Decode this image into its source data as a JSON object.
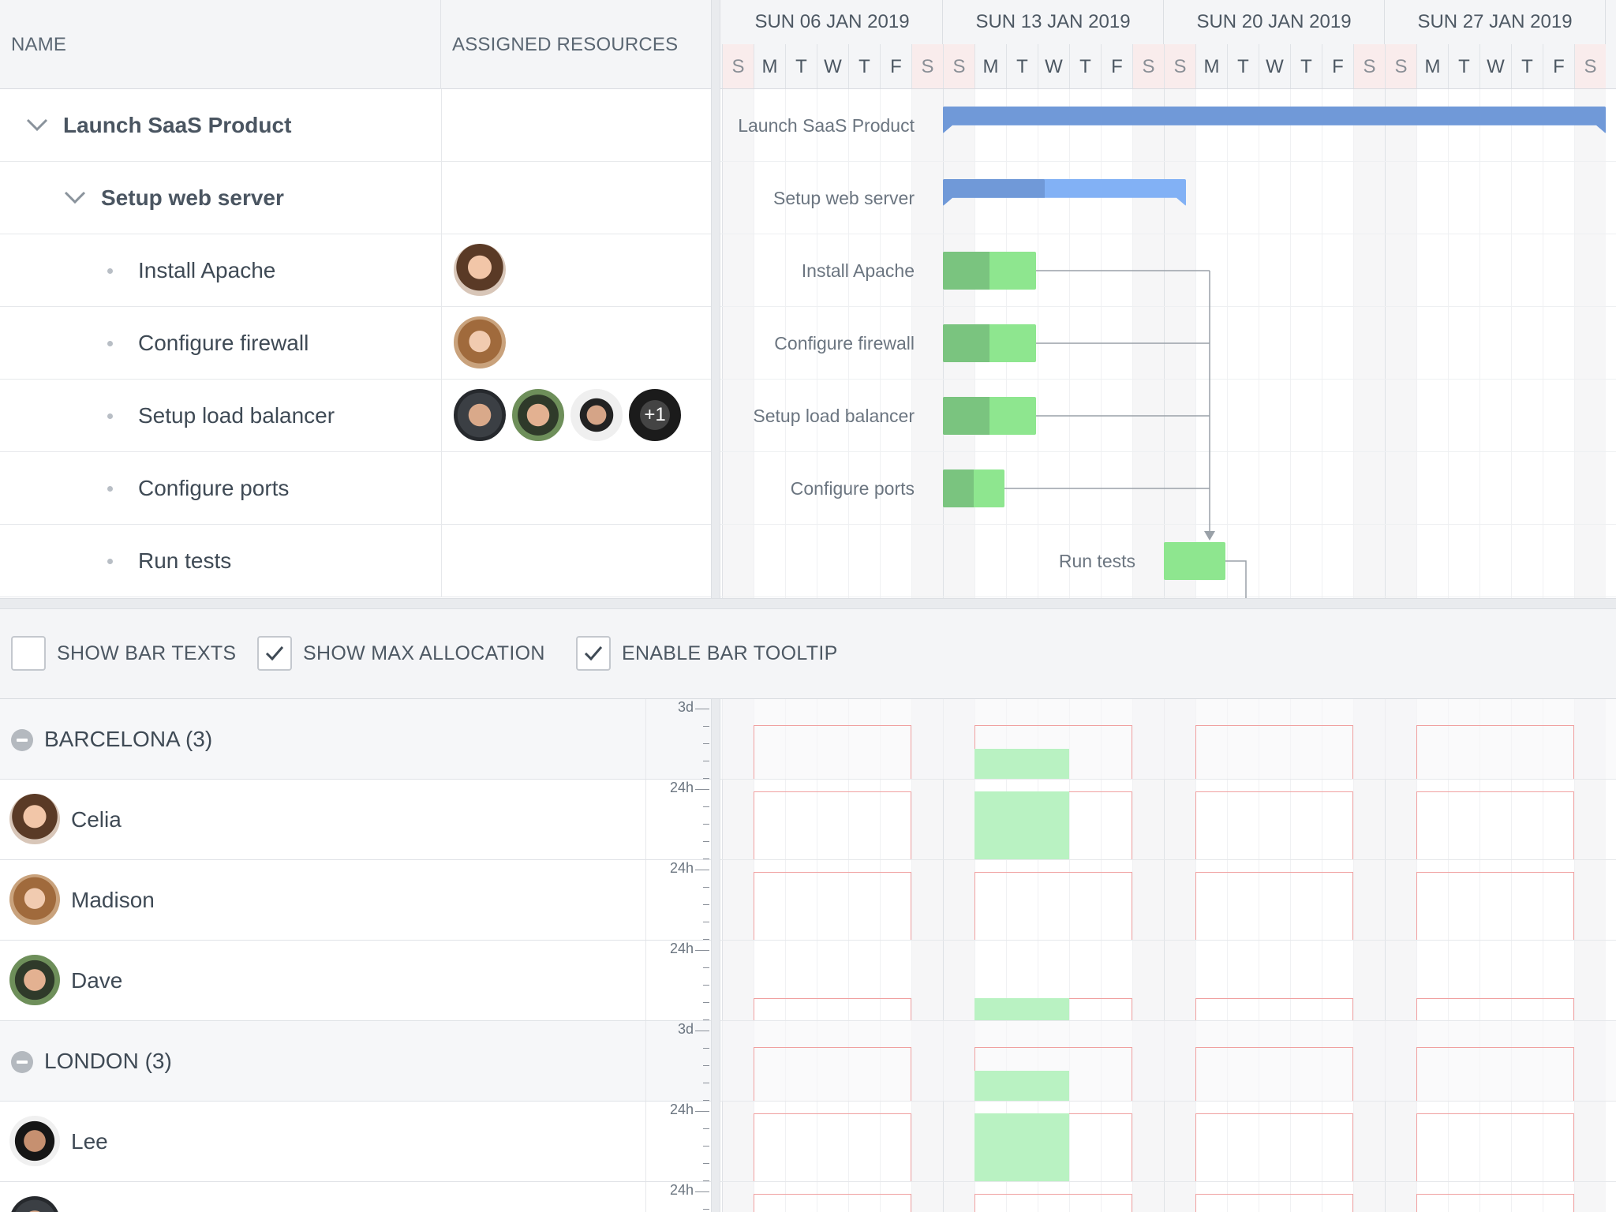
{
  "columns": {
    "name": "NAME",
    "resources": "ASSIGNED RESOURCES"
  },
  "weeks": [
    "SUN 06 JAN 2019",
    "SUN 13 JAN 2019",
    "SUN 20 JAN 2019",
    "SUN 27 JAN 2019"
  ],
  "days": [
    "S",
    "M",
    "T",
    "W",
    "T",
    "F",
    "S",
    "S",
    "M",
    "T",
    "W",
    "T",
    "F",
    "S",
    "S",
    "M",
    "T",
    "W",
    "T",
    "F",
    "S",
    "S",
    "M",
    "T",
    "W",
    "T",
    "F",
    "S"
  ],
  "tasks": [
    {
      "name": "Launch SaaS Product",
      "label": "Launch SaaS Product",
      "level": 0,
      "parent": true
    },
    {
      "name": "Setup web server",
      "label": "Setup web server",
      "level": 1,
      "parent": true
    },
    {
      "name": "Install Apache",
      "label": "Install Apache",
      "level": 2,
      "resources": [
        "celia"
      ]
    },
    {
      "name": "Configure firewall",
      "label": "Configure firewall",
      "level": 2,
      "resources": [
        "madison"
      ]
    },
    {
      "name": "Setup load balancer",
      "label": "Setup load balancer",
      "level": 2,
      "resources": [
        "man1",
        "dave",
        "man3",
        "more"
      ]
    },
    {
      "name": "Configure ports",
      "label": "Configure ports",
      "level": 2
    },
    {
      "name": "Run tests",
      "label": "Run tests",
      "level": 2
    }
  ],
  "more_badge": "+1",
  "toolbar": {
    "show_bar_texts": {
      "label": "SHOW BAR TEXTS",
      "checked": false
    },
    "show_max_allocation": {
      "label": "SHOW MAX ALLOCATION",
      "checked": true
    },
    "enable_bar_tooltip": {
      "label": "ENABLE BAR TOOLTIP",
      "checked": true
    }
  },
  "resources": [
    {
      "name": "BARCELONA (3)",
      "group": true,
      "scale": "3d"
    },
    {
      "name": "Celia",
      "group": false,
      "scale": "24h"
    },
    {
      "name": "Madison",
      "group": false,
      "scale": "24h"
    },
    {
      "name": "Dave",
      "group": false,
      "scale": "24h"
    },
    {
      "name": "LONDON (3)",
      "group": true,
      "scale": "3d"
    },
    {
      "name": "Lee",
      "group": false,
      "scale": "24h"
    },
    {
      "name": "",
      "group": false,
      "scale": "24h"
    }
  ],
  "colors": {
    "parent_bar": "#7099d8",
    "parent_progress": "#82b1f5",
    "task_done": "#7ac47f",
    "task_todo": "#8ee68f",
    "alloc_border": "#f0a0a0",
    "alloc_fill": "#b9f2c2"
  }
}
